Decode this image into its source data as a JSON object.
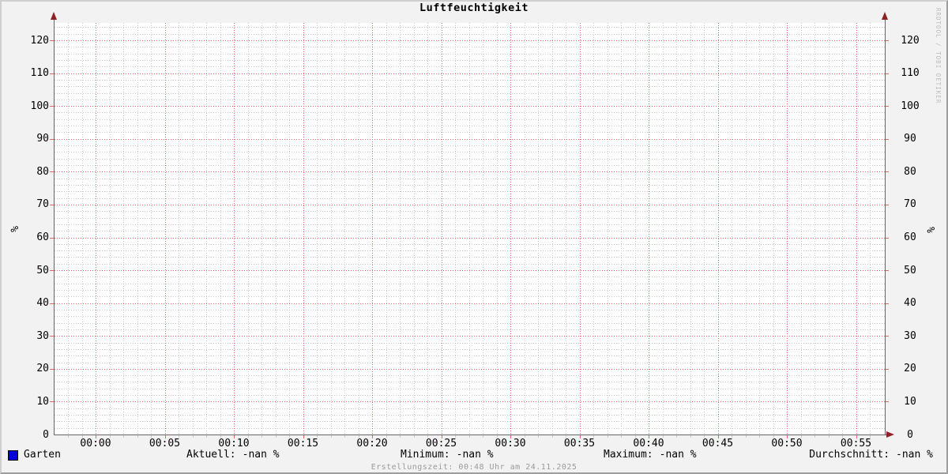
{
  "title": "Luftfeuchtigkeit",
  "y_axis": {
    "left_label": "%",
    "right_label": "%",
    "ticks": [
      "0",
      "10",
      "20",
      "30",
      "40",
      "50",
      "60",
      "70",
      "80",
      "90",
      "100",
      "110",
      "120"
    ]
  },
  "x_axis": {
    "ticks": [
      "00:00",
      "00:05",
      "00:10",
      "00:15",
      "00:20",
      "00:25",
      "00:30",
      "00:35",
      "00:40",
      "00:45",
      "00:50",
      "00:55"
    ]
  },
  "legend": {
    "series": {
      "label": "Garten",
      "color": "#0000dd"
    },
    "stats": [
      {
        "label": "Aktuell:",
        "value": "-nan %"
      },
      {
        "label": "Minimum:",
        "value": "-nan %"
      },
      {
        "label": "Maximum:",
        "value": "-nan %"
      },
      {
        "label": "Durchschnitt:",
        "value": "-nan %"
      }
    ]
  },
  "footer": {
    "creation_time": "Erstellungszeit: 00:48 Uhr am 24.11.2025"
  },
  "watermark": "RRDTOOL / TOBI OETIKER",
  "colors": {
    "background": "#f2f2f2",
    "canvas": "#ffffff",
    "axis": "#666666",
    "arrow": "#8e2222",
    "major_grid": "#e36666",
    "minor_grid": "#c9c9c9",
    "series_blue": "#0000dd"
  },
  "chart_data": {
    "type": "line",
    "title": "Luftfeuchtigkeit",
    "xlabel": "",
    "ylabel": "%",
    "ylim": [
      0,
      125
    ],
    "x_ticks": [
      "00:00",
      "00:05",
      "00:10",
      "00:15",
      "00:20",
      "00:25",
      "00:30",
      "00:35",
      "00:40",
      "00:45",
      "00:50",
      "00:55"
    ],
    "y_ticks": [
      0,
      10,
      20,
      30,
      40,
      50,
      60,
      70,
      80,
      90,
      100,
      110,
      120
    ],
    "x_tick_interval_minutes": 5,
    "grid": true,
    "legend_position": "bottom",
    "series": [
      {
        "name": "Garten",
        "color": "#0000dd",
        "values": [],
        "note": "no data plotted - all values NaN",
        "aktuell": "-nan %",
        "minimum": "-nan %",
        "maximum": "-nan %",
        "durchschnitt": "-nan %"
      }
    ],
    "annotations": [
      "Erstellungszeit: 00:48 Uhr am 24.11.2025"
    ]
  }
}
